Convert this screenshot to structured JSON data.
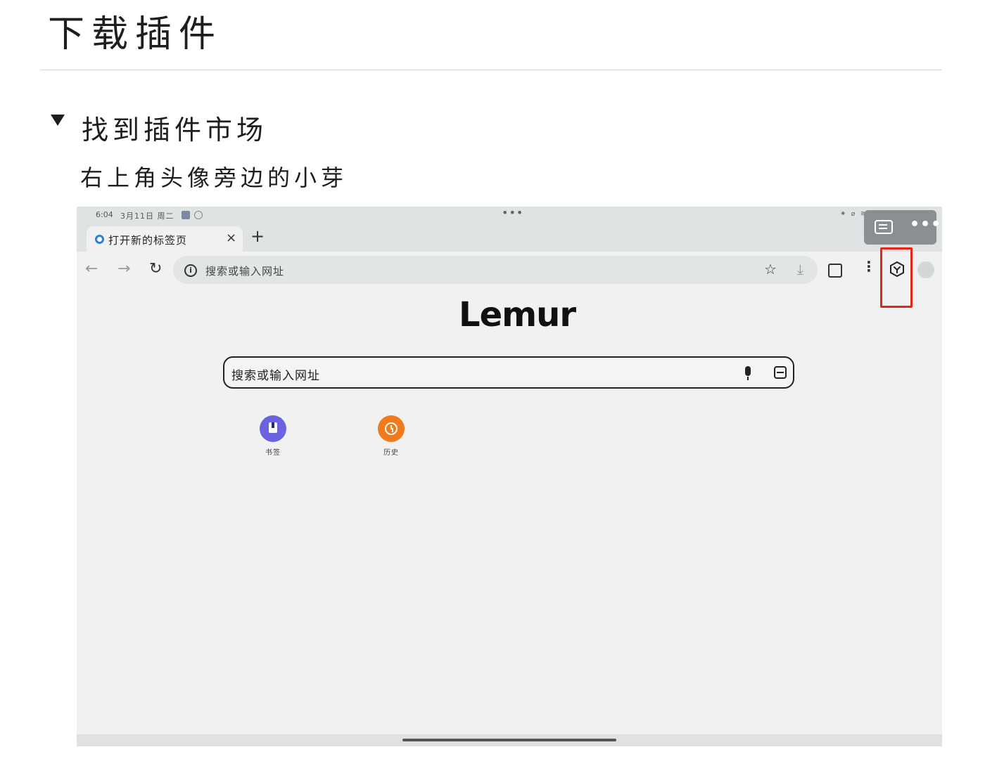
{
  "doc": {
    "title": "下载插件",
    "section_heading": "找到插件市场",
    "section_desc": "右上角头像旁边的小芽"
  },
  "screenshot": {
    "status": {
      "time": "6:04",
      "date": "3月11日 周二",
      "center_dots": "•••",
      "right_text": "⁕ ⌀ ≋ ▭ 17%"
    },
    "tab": {
      "title": "打开新的标签页",
      "close": "×",
      "new_tab": "+"
    },
    "float_panel": {
      "more": "•••"
    },
    "toolbar": {
      "back": "←",
      "forward": "→",
      "reload": "↻",
      "info": "i",
      "omnibox_placeholder": "搜索或输入网址",
      "star": "☆",
      "download": "⤓",
      "menu": "⋮"
    },
    "logo": "Lemur",
    "search": {
      "placeholder": "搜索或输入网址"
    },
    "shortcuts": [
      {
        "label": "书签",
        "icon": "bookmark-icon",
        "color": "#6b62e0"
      },
      {
        "label": "历史",
        "icon": "history-clock-icon",
        "color": "#f07a1c"
      }
    ],
    "highlight_color": "#e62417"
  }
}
